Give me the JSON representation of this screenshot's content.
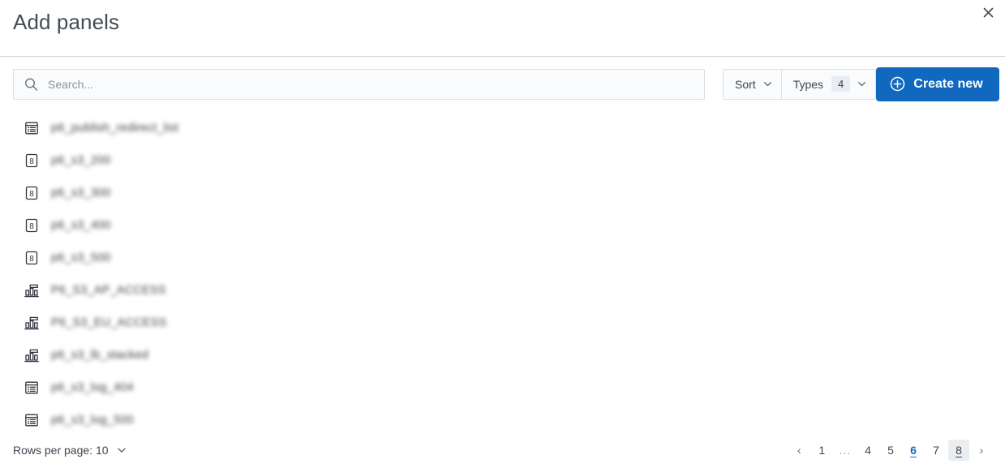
{
  "header": {
    "title": "Add panels",
    "close_label": "×"
  },
  "toolbar": {
    "search": {
      "placeholder": "Search...",
      "value": ""
    },
    "sort_label": "Sort",
    "types_label": "Types",
    "types_count": "4",
    "create_label": "Create new"
  },
  "list": {
    "rows": [
      {
        "label": "p6_publish_redirect_list",
        "icon": "table-icon"
      },
      {
        "label": "p6_s3_200",
        "icon": "single-value-icon"
      },
      {
        "label": "p6_s3_300",
        "icon": "single-value-icon"
      },
      {
        "label": "p6_s3_400",
        "icon": "single-value-icon"
      },
      {
        "label": "p6_s3_500",
        "icon": "single-value-icon"
      },
      {
        "label": "P6_S3_AP_ACCESS",
        "icon": "bar-chart-icon"
      },
      {
        "label": "P6_S3_EU_ACCESS",
        "icon": "bar-chart-icon"
      },
      {
        "label": "p6_s3_lb_stacked",
        "icon": "bar-chart-icon"
      },
      {
        "label": "p6_s3_log_404",
        "icon": "table-icon"
      },
      {
        "label": "p6_s3_log_500",
        "icon": "table-icon"
      }
    ]
  },
  "footer": {
    "rows_per_page_label": "Rows per page: 10",
    "pagination": [
      {
        "label": "‹",
        "kind": "arrow",
        "name": "previous-page-button"
      },
      {
        "label": "1",
        "kind": "page",
        "name": "page-1"
      },
      {
        "label": "...",
        "kind": "ellipsis",
        "name": "page-ellipsis"
      },
      {
        "label": "4",
        "kind": "page",
        "name": "page-4"
      },
      {
        "label": "5",
        "kind": "page",
        "name": "page-5"
      },
      {
        "label": "6",
        "kind": "current",
        "name": "page-6"
      },
      {
        "label": "7",
        "kind": "page",
        "name": "page-7"
      },
      {
        "label": "8",
        "kind": "hovered",
        "name": "page-8"
      },
      {
        "label": "›",
        "kind": "arrow",
        "name": "next-page-button"
      }
    ]
  },
  "colors": {
    "accent": "#1068bf",
    "text": "#3d4450",
    "border": "#dde1e6",
    "field_bg": "#fafbfc"
  }
}
